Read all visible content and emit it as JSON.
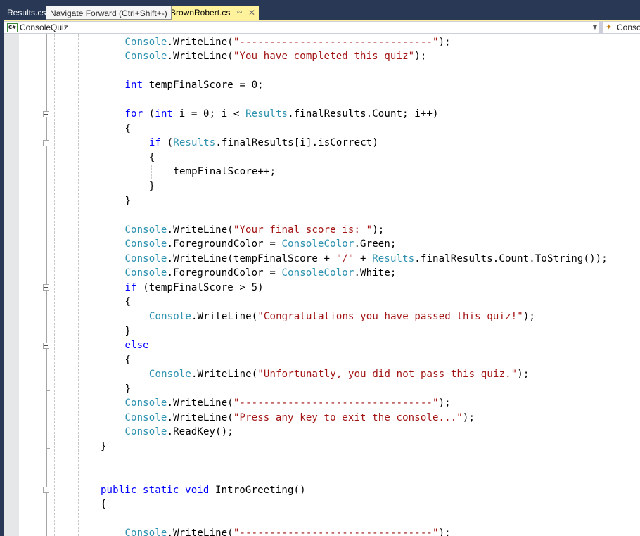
{
  "tabs": [
    {
      "label": "Results.cs",
      "active": false
    },
    {
      "label": "BrownRobert.cs",
      "active": true,
      "pinned_icon": "pin-icon",
      "close_icon": "close-icon"
    }
  ],
  "tooltip": "Navigate Forward (Ctrl+Shift+-)",
  "navbar": {
    "project_icon": "csharp-project-icon",
    "project_label": "ConsoleQuiz",
    "dropdown_icon": "dropdown-arrow-icon",
    "member_icon": "class-member-icon",
    "member_label": "Conso"
  },
  "colors": {
    "keyword": "#0000ff",
    "type": "#2b91af",
    "string": "#a31515",
    "plain": "#000000",
    "active_tab": "#fff29d",
    "titlebar": "#293955"
  },
  "code_lines": [
    {
      "indent": 12,
      "tokens": [
        {
          "t": "ty",
          "v": "Console"
        },
        {
          "t": "p",
          "v": ".WriteLine("
        },
        {
          "t": "str",
          "v": "\"--------------------------------\""
        },
        {
          "t": "p",
          "v": ");"
        }
      ]
    },
    {
      "indent": 12,
      "tokens": [
        {
          "t": "ty",
          "v": "Console"
        },
        {
          "t": "p",
          "v": ".WriteLine("
        },
        {
          "t": "str",
          "v": "\"You have completed this quiz\""
        },
        {
          "t": "p",
          "v": ");"
        }
      ]
    },
    {
      "indent": 0,
      "tokens": []
    },
    {
      "indent": 12,
      "tokens": [
        {
          "t": "kw",
          "v": "int"
        },
        {
          "t": "p",
          "v": " tempFinalScore = 0;"
        }
      ]
    },
    {
      "indent": 0,
      "tokens": []
    },
    {
      "indent": 12,
      "tokens": [
        {
          "t": "kw",
          "v": "for"
        },
        {
          "t": "p",
          "v": " ("
        },
        {
          "t": "kw",
          "v": "int"
        },
        {
          "t": "p",
          "v": " i = 0; i < "
        },
        {
          "t": "ty",
          "v": "Results"
        },
        {
          "t": "p",
          "v": ".finalResults.Count; i++)"
        }
      ]
    },
    {
      "indent": 12,
      "tokens": [
        {
          "t": "p",
          "v": "{"
        }
      ]
    },
    {
      "indent": 16,
      "tokens": [
        {
          "t": "kw",
          "v": "if"
        },
        {
          "t": "p",
          "v": " ("
        },
        {
          "t": "ty",
          "v": "Results"
        },
        {
          "t": "p",
          "v": ".finalResults[i].isCorrect)"
        }
      ]
    },
    {
      "indent": 16,
      "tokens": [
        {
          "t": "p",
          "v": "{"
        }
      ]
    },
    {
      "indent": 20,
      "tokens": [
        {
          "t": "p",
          "v": "tempFinalScore++;"
        }
      ]
    },
    {
      "indent": 16,
      "tokens": [
        {
          "t": "p",
          "v": "}"
        }
      ]
    },
    {
      "indent": 12,
      "tokens": [
        {
          "t": "p",
          "v": "}"
        }
      ]
    },
    {
      "indent": 0,
      "tokens": []
    },
    {
      "indent": 12,
      "tokens": [
        {
          "t": "ty",
          "v": "Console"
        },
        {
          "t": "p",
          "v": ".WriteLine("
        },
        {
          "t": "str",
          "v": "\"Your final score is: \""
        },
        {
          "t": "p",
          "v": ");"
        }
      ]
    },
    {
      "indent": 12,
      "tokens": [
        {
          "t": "ty",
          "v": "Console"
        },
        {
          "t": "p",
          "v": ".ForegroundColor = "
        },
        {
          "t": "ty",
          "v": "ConsoleColor"
        },
        {
          "t": "p",
          "v": ".Green;"
        }
      ]
    },
    {
      "indent": 12,
      "tokens": [
        {
          "t": "ty",
          "v": "Console"
        },
        {
          "t": "p",
          "v": ".WriteLine(tempFinalScore + "
        },
        {
          "t": "str",
          "v": "\"/\""
        },
        {
          "t": "p",
          "v": " + "
        },
        {
          "t": "ty",
          "v": "Results"
        },
        {
          "t": "p",
          "v": ".finalResults.Count.ToString());"
        }
      ]
    },
    {
      "indent": 12,
      "tokens": [
        {
          "t": "ty",
          "v": "Console"
        },
        {
          "t": "p",
          "v": ".ForegroundColor = "
        },
        {
          "t": "ty",
          "v": "ConsoleColor"
        },
        {
          "t": "p",
          "v": ".White;"
        }
      ]
    },
    {
      "indent": 12,
      "tokens": [
        {
          "t": "kw",
          "v": "if"
        },
        {
          "t": "p",
          "v": " (tempFinalScore > 5)"
        }
      ]
    },
    {
      "indent": 12,
      "tokens": [
        {
          "t": "p",
          "v": "{"
        }
      ]
    },
    {
      "indent": 16,
      "tokens": [
        {
          "t": "ty",
          "v": "Console"
        },
        {
          "t": "p",
          "v": ".WriteLine("
        },
        {
          "t": "str",
          "v": "\"Congratulations you have passed this quiz!\""
        },
        {
          "t": "p",
          "v": ");"
        }
      ]
    },
    {
      "indent": 12,
      "tokens": [
        {
          "t": "p",
          "v": "}"
        }
      ]
    },
    {
      "indent": 12,
      "tokens": [
        {
          "t": "kw",
          "v": "else"
        }
      ]
    },
    {
      "indent": 12,
      "tokens": [
        {
          "t": "p",
          "v": "{"
        }
      ]
    },
    {
      "indent": 16,
      "tokens": [
        {
          "t": "ty",
          "v": "Console"
        },
        {
          "t": "p",
          "v": ".WriteLine("
        },
        {
          "t": "str",
          "v": "\"Unfortunatly, you did not pass this quiz.\""
        },
        {
          "t": "p",
          "v": ");"
        }
      ]
    },
    {
      "indent": 12,
      "tokens": [
        {
          "t": "p",
          "v": "}"
        }
      ]
    },
    {
      "indent": 12,
      "tokens": [
        {
          "t": "ty",
          "v": "Console"
        },
        {
          "t": "p",
          "v": ".WriteLine("
        },
        {
          "t": "str",
          "v": "\"--------------------------------\""
        },
        {
          "t": "p",
          "v": ");"
        }
      ]
    },
    {
      "indent": 12,
      "tokens": [
        {
          "t": "ty",
          "v": "Console"
        },
        {
          "t": "p",
          "v": ".WriteLine("
        },
        {
          "t": "str",
          "v": "\"Press any key to exit the console...\""
        },
        {
          "t": "p",
          "v": ");"
        }
      ]
    },
    {
      "indent": 12,
      "tokens": [
        {
          "t": "ty",
          "v": "Console"
        },
        {
          "t": "p",
          "v": ".ReadKey();"
        }
      ]
    },
    {
      "indent": 8,
      "tokens": [
        {
          "t": "p",
          "v": "}"
        }
      ]
    },
    {
      "indent": 0,
      "tokens": []
    },
    {
      "indent": 0,
      "tokens": []
    },
    {
      "indent": 8,
      "tokens": [
        {
          "t": "kw",
          "v": "public"
        },
        {
          "t": "p",
          "v": " "
        },
        {
          "t": "kw",
          "v": "static"
        },
        {
          "t": "p",
          "v": " "
        },
        {
          "t": "kw",
          "v": "void"
        },
        {
          "t": "p",
          "v": " IntroGreeting()"
        }
      ]
    },
    {
      "indent": 8,
      "tokens": [
        {
          "t": "p",
          "v": "{"
        }
      ]
    },
    {
      "indent": 0,
      "tokens": []
    },
    {
      "indent": 12,
      "tokens": [
        {
          "t": "ty",
          "v": "Console"
        },
        {
          "t": "p",
          "v": ".WriteLine("
        },
        {
          "t": "str",
          "v": "\"--------------------------------\""
        },
        {
          "t": "p",
          "v": ");"
        }
      ]
    }
  ],
  "collapse_markers_at_lines": [
    5,
    7,
    17,
    21,
    31
  ]
}
